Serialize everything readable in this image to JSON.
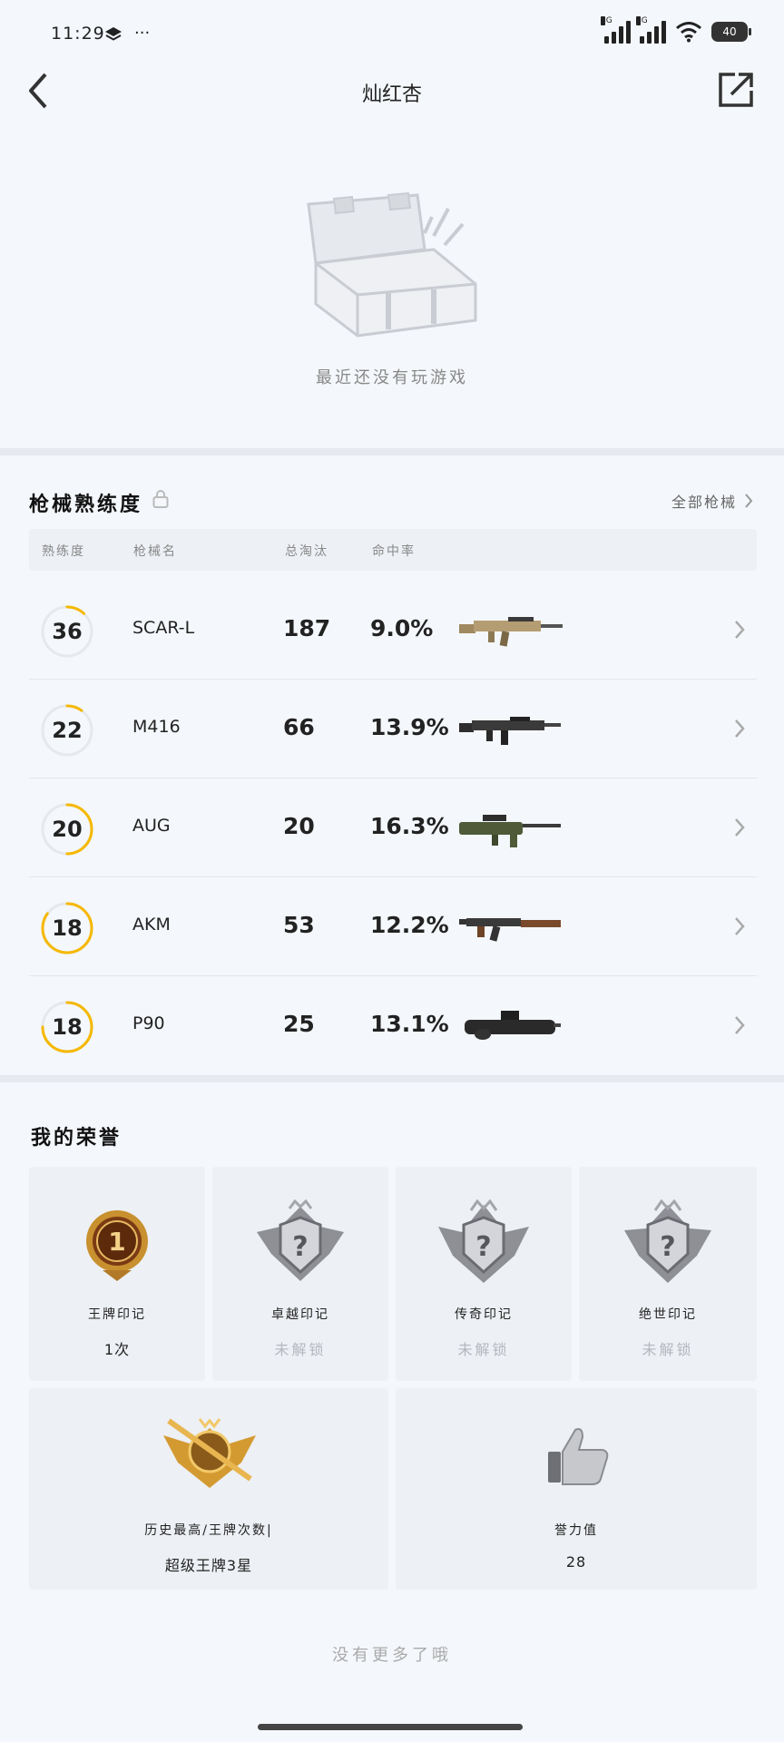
{
  "status_bar": {
    "time": "11:29",
    "more": "···",
    "net1": "4G",
    "net2": "4G",
    "battery": "40"
  },
  "header": {
    "title": "灿红杏"
  },
  "empty_state": {
    "text": "最近还没有玩游戏"
  },
  "weapons": {
    "title": "枪械熟练度",
    "all_link": "全部枪械",
    "columns": {
      "level": "熟练度",
      "name": "枪械名",
      "kills": "总淘汰",
      "accuracy": "命中率"
    },
    "rows": [
      {
        "level": "36",
        "name": "SCAR-L",
        "kills": "187",
        "accuracy": "9.0%",
        "progress": 0.12
      },
      {
        "level": "22",
        "name": "M416",
        "kills": "66",
        "accuracy": "13.9%",
        "progress": 0.1
      },
      {
        "level": "20",
        "name": "AUG",
        "kills": "20",
        "accuracy": "16.3%",
        "progress": 0.5
      },
      {
        "level": "18",
        "name": "AKM",
        "kills": "53",
        "accuracy": "12.2%",
        "progress": 0.85
      },
      {
        "level": "18",
        "name": "P90",
        "kills": "25",
        "accuracy": "13.1%",
        "progress": 0.75
      }
    ]
  },
  "honors": {
    "title": "我的荣誉",
    "cards": [
      {
        "label": "王牌印记",
        "value": "1次"
      },
      {
        "label": "卓越印记",
        "value": "未解锁"
      },
      {
        "label": "传奇印记",
        "value": "未解锁"
      },
      {
        "label": "绝世印记",
        "value": "未解锁"
      }
    ],
    "highest": {
      "label": "历史最高/王牌次数|",
      "value": "超级王牌3星"
    },
    "reputation": {
      "label": "誉力值",
      "value": "28"
    }
  },
  "footer": {
    "text": "没有更多了哦"
  },
  "colors": {
    "accent": "#f5b800",
    "ring_track": "#e6e8ec"
  }
}
